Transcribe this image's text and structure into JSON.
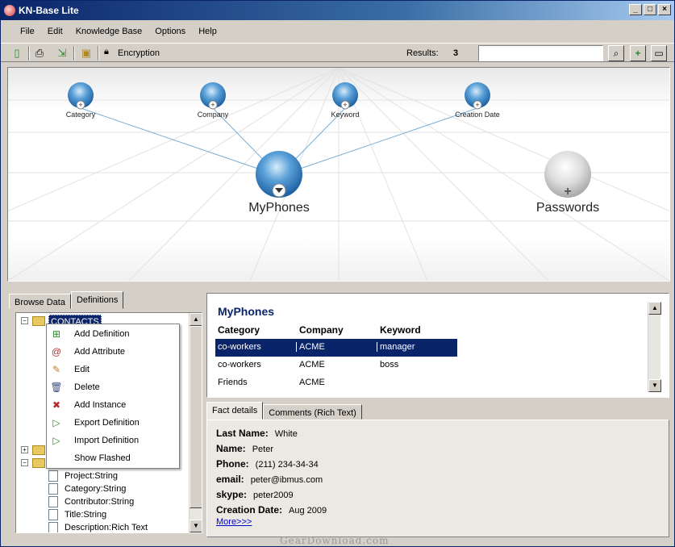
{
  "window": {
    "title": "KN-Base Lite"
  },
  "menu": [
    "File",
    "Edit",
    "Knowledge Base",
    "Options",
    "Help"
  ],
  "toolbar": {
    "encryption_label": "Encryption",
    "results_label": "Results:",
    "results_count": "3",
    "search_value": ""
  },
  "graph": {
    "attributes": [
      "Category",
      "Company",
      "Keyword",
      "Creation Date"
    ],
    "knowledge_bases": [
      "MyPhones",
      "Passwords"
    ],
    "colors": {
      "active_node": "#3a86c8",
      "inactive_node": "#d8d8d8",
      "link": "#7ab0d8"
    }
  },
  "left_tabs": [
    "Browse Data",
    "Definitions"
  ],
  "tree": {
    "root": "CONTACTS",
    "fields": [
      "Project:String",
      "Category:String",
      "Contributor:String",
      "Title:String",
      "Description:Rich Text"
    ]
  },
  "context_menu": [
    {
      "label": "Add Definition",
      "icon": "add-definition-icon"
    },
    {
      "label": "Add Attribute",
      "icon": "add-attribute-icon"
    },
    {
      "label": "Edit",
      "icon": "pencil-icon"
    },
    {
      "label": "Delete",
      "icon": "trash-icon"
    },
    {
      "label": "Add Instance",
      "icon": "add-instance-icon"
    },
    {
      "label": "Export Definition",
      "icon": "export-icon"
    },
    {
      "label": "Import Definition",
      "icon": "import-icon"
    },
    {
      "label": "Show Flashed",
      "icon": ""
    }
  ],
  "results": {
    "title": "MyPhones",
    "columns": [
      "Category",
      "Company",
      "Keyword"
    ],
    "rows": [
      [
        "co-workers",
        "ACME",
        "manager"
      ],
      [
        "co-workers",
        "ACME",
        "boss"
      ],
      [
        "Friends",
        "ACME",
        ""
      ]
    ]
  },
  "detail_tabs": [
    "Fact details",
    "Comments (Rich Text)"
  ],
  "facts": [
    {
      "label": "Last Name:",
      "value": "White"
    },
    {
      "label": "Name:",
      "value": "Peter"
    },
    {
      "label": "Phone:",
      "value": "(211) 234-34-34"
    },
    {
      "label": "email:",
      "value": "peter@ibmus.com"
    },
    {
      "label": "skype:",
      "value": "peter2009"
    },
    {
      "label": "Creation Date:",
      "value": "Aug 2009"
    }
  ],
  "more_link": "More>>>",
  "watermark": "GearDownload.com"
}
